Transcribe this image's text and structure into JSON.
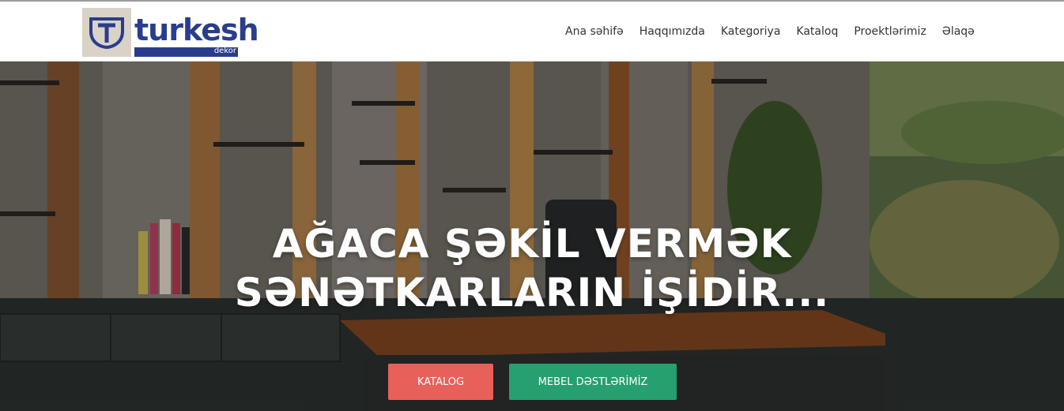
{
  "logo": {
    "word": "turkesh",
    "sub": "dekor",
    "brand_color": "#2a3d8c",
    "box_color": "#d9d3c7"
  },
  "nav": {
    "items": [
      {
        "label": "Ana səhifə"
      },
      {
        "label": "Haqqımızda"
      },
      {
        "label": "Kategoriya"
      },
      {
        "label": "Kataloq"
      },
      {
        "label": "Proektlərimiz"
      },
      {
        "label": "Əlaqə"
      }
    ]
  },
  "hero": {
    "line1": "AĞACA ŞƏKİL VERMƏK",
    "line2": "SƏNƏTKARLARIN İŞİDİR...",
    "buttons": {
      "katalog": {
        "label": "KATALOG",
        "color": "#e8605a"
      },
      "mebel": {
        "label": "MEBEL DƏSTLƏRİMİZ",
        "color": "#26a06e"
      }
    }
  }
}
